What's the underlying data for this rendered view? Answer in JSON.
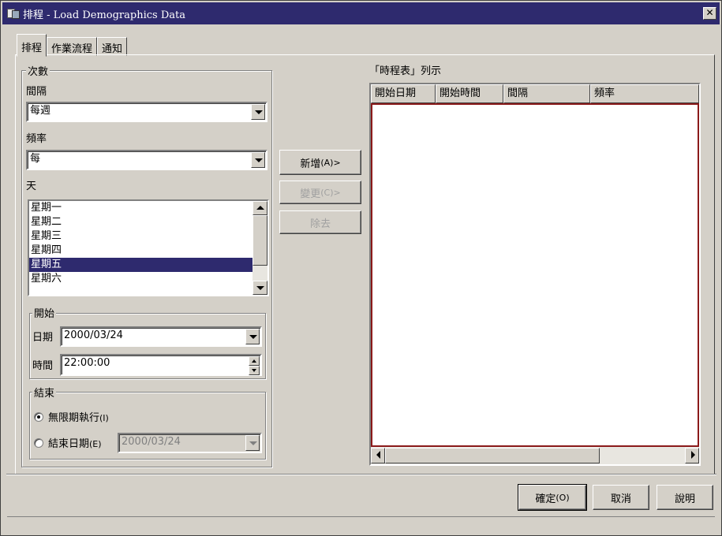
{
  "window": {
    "title": "排程 - Load Demographics Data",
    "close_label": "✕"
  },
  "tabs": [
    {
      "label": "排程",
      "active": true
    },
    {
      "label": "作業流程",
      "active": false
    },
    {
      "label": "通知",
      "active": false
    }
  ],
  "frequency_group": {
    "legend": "次數",
    "interval_label": "間隔",
    "interval_value": "每週",
    "frequency_label": "頻率",
    "frequency_value": "每",
    "day_label": "天",
    "days": [
      {
        "label": "星期一",
        "selected": false
      },
      {
        "label": "星期二",
        "selected": false
      },
      {
        "label": "星期三",
        "selected": false
      },
      {
        "label": "星期四",
        "selected": false
      },
      {
        "label": "星期五",
        "selected": true
      },
      {
        "label": "星期六",
        "selected": false
      }
    ]
  },
  "start_group": {
    "legend": "開始",
    "date_label": "日期",
    "date_value": "2000/03/24",
    "time_label": "時間",
    "time_value": "22:00:00"
  },
  "end_group": {
    "legend": "結束",
    "unlimited_label": "無限期執行",
    "unlimited_accel": "(I)",
    "unlimited_selected": true,
    "end_date_label": "結束日期",
    "end_date_accel": "(E)",
    "end_date_value": "2000/03/24"
  },
  "actions": {
    "add": {
      "label": "新增",
      "accel": "(A)",
      "suffix": " >",
      "enabled": true
    },
    "change": {
      "label": "變更",
      "accel": "(C)",
      "suffix": " >",
      "enabled": false
    },
    "remove": {
      "label": "除去",
      "enabled": false
    }
  },
  "schedule_list": {
    "title": "「時程表」列示",
    "columns": [
      "開始日期",
      "開始時間",
      "間隔",
      "頻率"
    ],
    "rows": []
  },
  "footer": {
    "ok": {
      "label": "確定",
      "accel": "(O)"
    },
    "cancel": {
      "label": "取消"
    },
    "help": {
      "label": "說明"
    }
  }
}
